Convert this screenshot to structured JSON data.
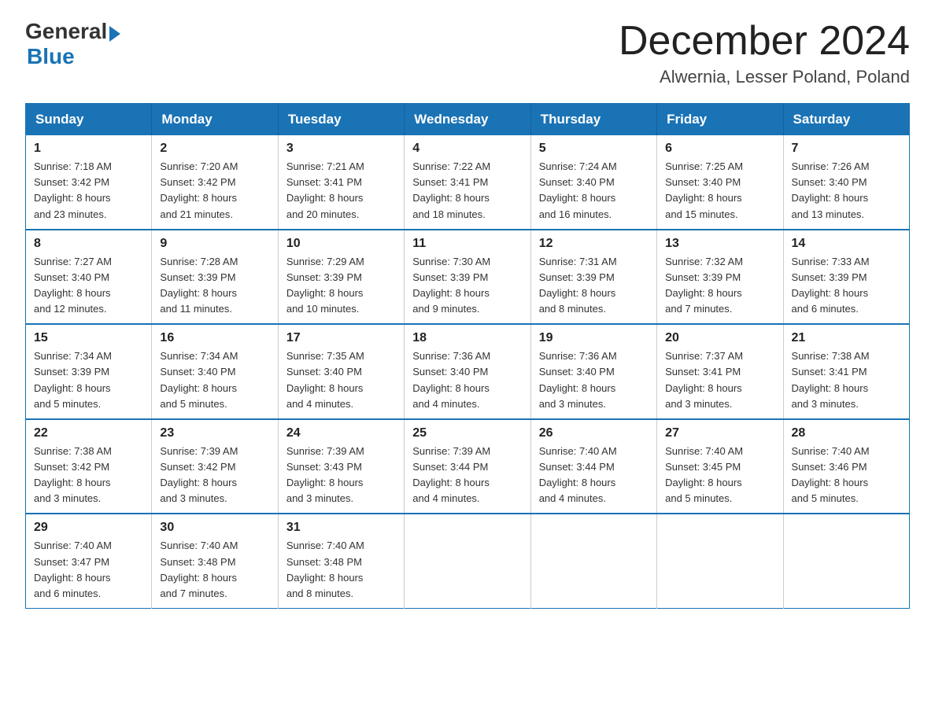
{
  "header": {
    "logo_general": "General",
    "logo_blue": "Blue",
    "title": "December 2024",
    "location": "Alwernia, Lesser Poland, Poland"
  },
  "calendar": {
    "weekdays": [
      "Sunday",
      "Monday",
      "Tuesday",
      "Wednesday",
      "Thursday",
      "Friday",
      "Saturday"
    ],
    "weeks": [
      [
        {
          "day": "1",
          "sunrise": "7:18 AM",
          "sunset": "3:42 PM",
          "daylight": "8 hours and 23 minutes."
        },
        {
          "day": "2",
          "sunrise": "7:20 AM",
          "sunset": "3:42 PM",
          "daylight": "8 hours and 21 minutes."
        },
        {
          "day": "3",
          "sunrise": "7:21 AM",
          "sunset": "3:41 PM",
          "daylight": "8 hours and 20 minutes."
        },
        {
          "day": "4",
          "sunrise": "7:22 AM",
          "sunset": "3:41 PM",
          "daylight": "8 hours and 18 minutes."
        },
        {
          "day": "5",
          "sunrise": "7:24 AM",
          "sunset": "3:40 PM",
          "daylight": "8 hours and 16 minutes."
        },
        {
          "day": "6",
          "sunrise": "7:25 AM",
          "sunset": "3:40 PM",
          "daylight": "8 hours and 15 minutes."
        },
        {
          "day": "7",
          "sunrise": "7:26 AM",
          "sunset": "3:40 PM",
          "daylight": "8 hours and 13 minutes."
        }
      ],
      [
        {
          "day": "8",
          "sunrise": "7:27 AM",
          "sunset": "3:40 PM",
          "daylight": "8 hours and 12 minutes."
        },
        {
          "day": "9",
          "sunrise": "7:28 AM",
          "sunset": "3:39 PM",
          "daylight": "8 hours and 11 minutes."
        },
        {
          "day": "10",
          "sunrise": "7:29 AM",
          "sunset": "3:39 PM",
          "daylight": "8 hours and 10 minutes."
        },
        {
          "day": "11",
          "sunrise": "7:30 AM",
          "sunset": "3:39 PM",
          "daylight": "8 hours and 9 minutes."
        },
        {
          "day": "12",
          "sunrise": "7:31 AM",
          "sunset": "3:39 PM",
          "daylight": "8 hours and 8 minutes."
        },
        {
          "day": "13",
          "sunrise": "7:32 AM",
          "sunset": "3:39 PM",
          "daylight": "8 hours and 7 minutes."
        },
        {
          "day": "14",
          "sunrise": "7:33 AM",
          "sunset": "3:39 PM",
          "daylight": "8 hours and 6 minutes."
        }
      ],
      [
        {
          "day": "15",
          "sunrise": "7:34 AM",
          "sunset": "3:39 PM",
          "daylight": "8 hours and 5 minutes."
        },
        {
          "day": "16",
          "sunrise": "7:34 AM",
          "sunset": "3:40 PM",
          "daylight": "8 hours and 5 minutes."
        },
        {
          "day": "17",
          "sunrise": "7:35 AM",
          "sunset": "3:40 PM",
          "daylight": "8 hours and 4 minutes."
        },
        {
          "day": "18",
          "sunrise": "7:36 AM",
          "sunset": "3:40 PM",
          "daylight": "8 hours and 4 minutes."
        },
        {
          "day": "19",
          "sunrise": "7:36 AM",
          "sunset": "3:40 PM",
          "daylight": "8 hours and 3 minutes."
        },
        {
          "day": "20",
          "sunrise": "7:37 AM",
          "sunset": "3:41 PM",
          "daylight": "8 hours and 3 minutes."
        },
        {
          "day": "21",
          "sunrise": "7:38 AM",
          "sunset": "3:41 PM",
          "daylight": "8 hours and 3 minutes."
        }
      ],
      [
        {
          "day": "22",
          "sunrise": "7:38 AM",
          "sunset": "3:42 PM",
          "daylight": "8 hours and 3 minutes."
        },
        {
          "day": "23",
          "sunrise": "7:39 AM",
          "sunset": "3:42 PM",
          "daylight": "8 hours and 3 minutes."
        },
        {
          "day": "24",
          "sunrise": "7:39 AM",
          "sunset": "3:43 PM",
          "daylight": "8 hours and 3 minutes."
        },
        {
          "day": "25",
          "sunrise": "7:39 AM",
          "sunset": "3:44 PM",
          "daylight": "8 hours and 4 minutes."
        },
        {
          "day": "26",
          "sunrise": "7:40 AM",
          "sunset": "3:44 PM",
          "daylight": "8 hours and 4 minutes."
        },
        {
          "day": "27",
          "sunrise": "7:40 AM",
          "sunset": "3:45 PM",
          "daylight": "8 hours and 5 minutes."
        },
        {
          "day": "28",
          "sunrise": "7:40 AM",
          "sunset": "3:46 PM",
          "daylight": "8 hours and 5 minutes."
        }
      ],
      [
        {
          "day": "29",
          "sunrise": "7:40 AM",
          "sunset": "3:47 PM",
          "daylight": "8 hours and 6 minutes."
        },
        {
          "day": "30",
          "sunrise": "7:40 AM",
          "sunset": "3:48 PM",
          "daylight": "8 hours and 7 minutes."
        },
        {
          "day": "31",
          "sunrise": "7:40 AM",
          "sunset": "3:48 PM",
          "daylight": "8 hours and 8 minutes."
        },
        null,
        null,
        null,
        null
      ]
    ]
  },
  "labels": {
    "sunrise": "Sunrise:",
    "sunset": "Sunset:",
    "daylight": "Daylight:"
  }
}
